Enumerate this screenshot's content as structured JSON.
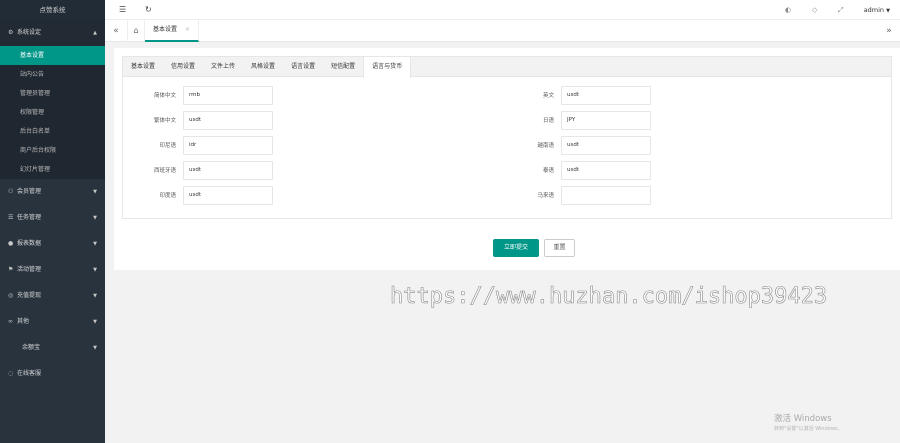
{
  "app": {
    "logo": "点赞系统"
  },
  "sidebar": {
    "groups": [
      {
        "label": "系统设定",
        "icon": "gear-icon"
      },
      {
        "label": "会员管理",
        "icon": "user-icon"
      },
      {
        "label": "任务管理",
        "icon": "list-icon"
      },
      {
        "label": "报表数据",
        "icon": "chart-icon"
      },
      {
        "label": "活动管理",
        "icon": "flag-icon"
      },
      {
        "label": "充值提现",
        "icon": "money-icon"
      },
      {
        "label": "其他",
        "icon": "more-icon"
      },
      {
        "label": "余额宝",
        "icon": ""
      },
      {
        "label": "在线客服",
        "icon": "service-icon"
      }
    ],
    "sub_items": [
      "基本设置",
      "站内公告",
      "管理员管理",
      "权限管理",
      "后台白名单",
      "商户后台权限",
      "幻灯片管理"
    ]
  },
  "topbar": {
    "user": "admin"
  },
  "tabstrip": {
    "page_tab": "基本设置"
  },
  "tabs": [
    "基本设置",
    "信用设置",
    "文件上传",
    "风格设置",
    "语言设置",
    "短信配置",
    "语言与货币"
  ],
  "form": {
    "left": [
      {
        "label": "简体中文",
        "value": "rmb"
      },
      {
        "label": "繁体中文",
        "value": "usdt"
      },
      {
        "label": "印尼语",
        "value": "idr"
      },
      {
        "label": "西班牙语",
        "value": "usdt"
      },
      {
        "label": "印度语",
        "value": "usdt"
      }
    ],
    "right": [
      {
        "label": "英文",
        "value": "usdt"
      },
      {
        "label": "日语",
        "value": "JPY"
      },
      {
        "label": "越南语",
        "value": "usdt"
      },
      {
        "label": "泰语",
        "value": "usdt"
      },
      {
        "label": "马来语",
        "value": ""
      }
    ]
  },
  "buttons": {
    "submit": "立即提交",
    "reset": "重置"
  },
  "watermark": "https://www.huzhan.com/ishop39423",
  "activate": {
    "title": "激活 Windows",
    "subtitle": "转到\"设置\"以激活 Windows。"
  },
  "colors": {
    "accent": "#009688",
    "sidebar_bg": "#28333e"
  }
}
